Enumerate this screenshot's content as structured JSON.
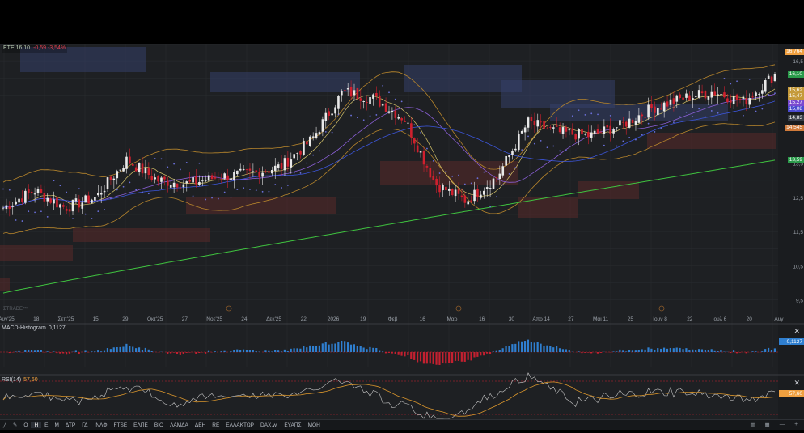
{
  "legend": {
    "symbol": "ETE 16,10",
    "change": "-0,59 -3,54%"
  },
  "watermark": "ΣΤRADE™",
  "price_axis": {
    "ticks": [
      "16,5",
      "13,5",
      "12,5",
      "11,5",
      "10,5",
      "9,5"
    ],
    "tags": [
      {
        "text": "16,764",
        "color": "#f0a040"
      },
      {
        "text": "16,10",
        "color": "#2a9a4a"
      },
      {
        "text": "15,62",
        "color": "#c59a3a"
      },
      {
        "text": "15,47",
        "color": "#c59a3a"
      },
      {
        "text": "15,27",
        "color": "#7a4ad0"
      },
      {
        "text": "15,08",
        "color": "#4a4ad0"
      },
      {
        "text": "14,83",
        "color": "#3a3f48"
      },
      {
        "text": "14,545",
        "color": "#d07a3a"
      },
      {
        "text": "13,59",
        "color": "#2a9a4a"
      }
    ]
  },
  "time_axis": [
    "Αυγ'25",
    "18",
    "Σεπ'25",
    "15",
    "29",
    "Οκτ'25",
    "27",
    "Νοε'25",
    "24",
    "Δεκ'25",
    "22",
    "2026",
    "19",
    "Φεβ",
    "16",
    "Μαρ",
    "16",
    "30",
    "Απρ 14",
    "27",
    "Μαι 11",
    "25",
    "Ιουν 8",
    "22",
    "Ιουλ 6",
    "20",
    "Αυγ"
  ],
  "macd": {
    "label": "MACD-Histogram",
    "value": "0,1127",
    "tag": "0,1127"
  },
  "rsi": {
    "label": "RSI(14)",
    "value": "57,60",
    "tag": "57,60"
  },
  "toolbar": {
    "items": [
      "Ο",
      "Η",
      "Ε",
      "Μ",
      "ΔΤΡ",
      "ΓΔ",
      "ΙΝΛΦ",
      "FTSE",
      "ΕΛΠΕ",
      "ΒΙΟ",
      "ΛΑΜΔΑ",
      "ΔΕΗ",
      "RE",
      "ΕΛΛΑΚΤΩΡ",
      "DAX.wi",
      "ΕΥΑΠΣ",
      "ΜΟΗ"
    ],
    "active_index": 1
  },
  "chart_data": {
    "type": "candlestick",
    "symbol": "ETE",
    "last": 16.1,
    "change": -0.59,
    "change_pct": -3.54,
    "ylim": [
      9.3,
      17.0
    ],
    "close_trend_checkpoints": [
      [
        "Αυγ'25",
        12.2
      ],
      [
        "Σεπ'25",
        12.7
      ],
      [
        "15",
        12.2
      ],
      [
        "29",
        12.5
      ],
      [
        "Οκτ'25",
        13.6
      ],
      [
        "27",
        13.0
      ],
      [
        "Νοε'25",
        12.9
      ],
      [
        "24",
        13.1
      ],
      [
        "Δεκ'25",
        13.2
      ],
      [
        "22",
        13.4
      ],
      [
        "2026",
        14.2
      ],
      [
        "19",
        15.6
      ],
      [
        "Φεβ",
        15.4
      ],
      [
        "16",
        14.8
      ],
      [
        "Μαρ",
        12.9
      ],
      [
        "16",
        12.4
      ],
      [
        "30",
        13.1
      ],
      [
        "Απρ 14",
        14.7
      ],
      [
        "27",
        14.4
      ],
      [
        "Μαι 11",
        14.3
      ],
      [
        "25",
        14.6
      ],
      [
        "Ιουν 8",
        15.1
      ],
      [
        "22",
        15.4
      ],
      [
        "Ιουλ 6",
        15.6
      ],
      [
        "20",
        15.3
      ],
      [
        "Αυγ",
        16.1
      ]
    ],
    "indicators": {
      "macd_histogram_last": 0.1127,
      "rsi14_last": 57.6,
      "sma200_last": 13.59
    }
  }
}
